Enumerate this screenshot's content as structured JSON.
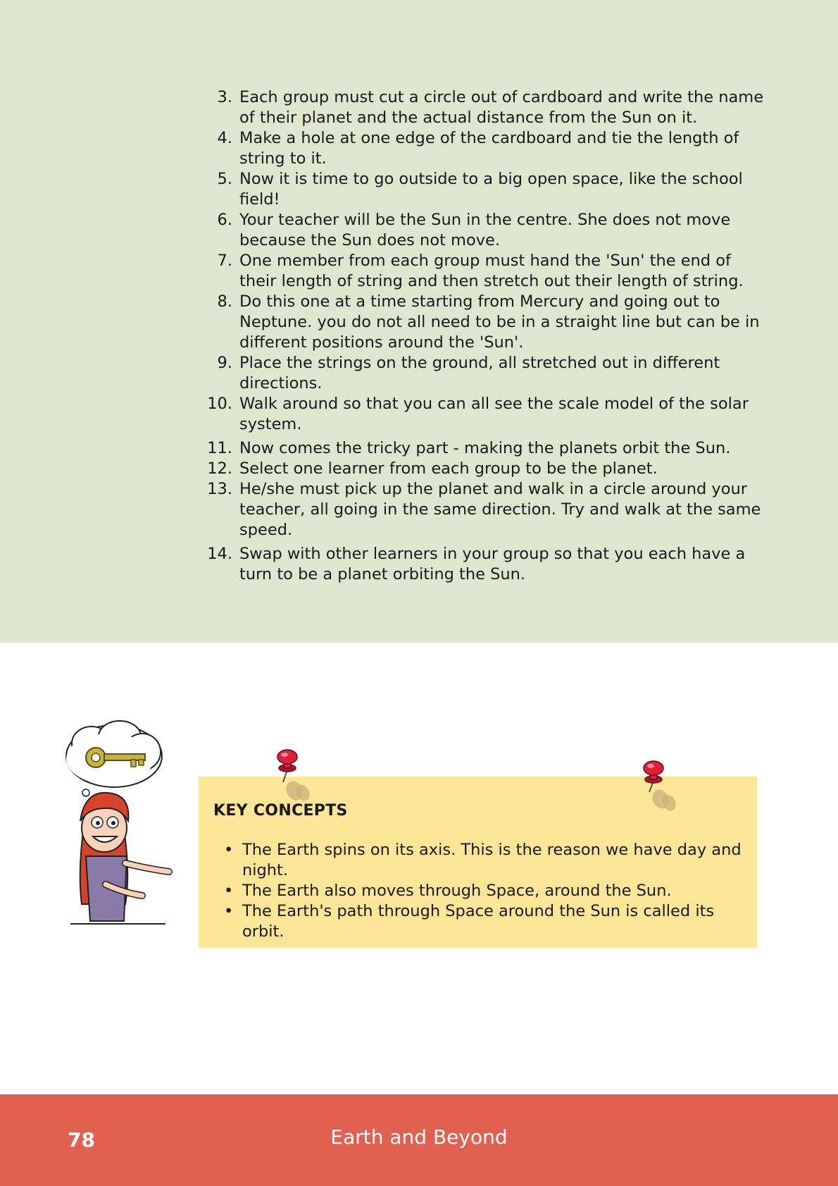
{
  "steps": [
    {
      "num": "3.",
      "text": "Each group must cut a circle out of cardboard and write the name of their planet and the actual distance from the Sun on it."
    },
    {
      "num": "4.",
      "text": "Make a hole at one edge of the cardboard and tie the length of string to it."
    },
    {
      "num": "5.",
      "text": "Now it is time to go outside to a big open space, like the school field!"
    },
    {
      "num": "6.",
      "text": "Your teacher will be the Sun in the centre. She does not move because the Sun does not move."
    },
    {
      "num": "7.",
      "text": "One member from each group must hand the 'Sun' the end of their length of string and then stretch out their length of string."
    },
    {
      "num": "8.",
      "text": "Do this one at a time starting from Mercury and going out to Neptune. you do not all need to be in a straight line but can be in different positions around the 'Sun'."
    },
    {
      "num": "9.",
      "text": "Place the strings on the ground, all stretched out in different directions."
    },
    {
      "num": "10.",
      "text": "Walk around so that you can all see the scale model of the solar system."
    },
    {
      "num": "11.",
      "text": "Now comes the tricky part - making the planets orbit the Sun."
    },
    {
      "num": "12.",
      "text": "Select one learner from each group to be the planet."
    },
    {
      "num": "13.",
      "text": "He/she must pick up the planet and walk in a circle around your teacher, all going in the same direction. Try and walk at the same speed."
    },
    {
      "num": "14.",
      "text": "Swap with other learners in your group so that you each have a turn to be a planet orbiting the Sun."
    }
  ],
  "key_concepts": {
    "title": "KEY CONCEPTS",
    "bullet": "•",
    "items": [
      "The Earth spins on its axis. This is the reason we have day and night.",
      "The Earth also moves through Space, around the Sun.",
      "The Earth's path through Space around the Sun is called its orbit."
    ]
  },
  "footer": {
    "page_number": "78",
    "chapter_title": "Earth and Beyond"
  },
  "colors": {
    "activity_bg": "#e0e5cf",
    "note_bg": "#fbe596",
    "footer_bg": "#e26050",
    "pin": "#e0203a"
  }
}
